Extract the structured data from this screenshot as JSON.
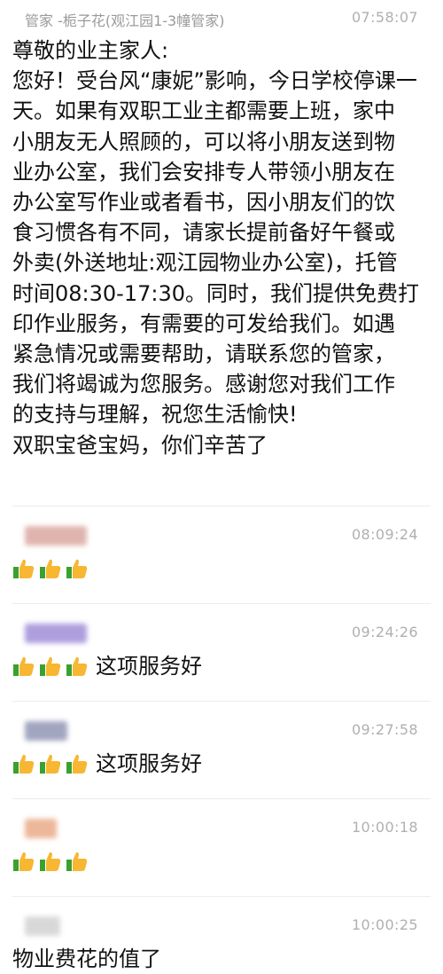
{
  "first_message": {
    "sender": "管家 -栀子花(观江园1-3幢管家)",
    "time": "07:58:07",
    "body": "尊敬的业主家人:\n您好！受台风“康妮”影响，今日学校停课一\n天。如果有双职工业主都需要上班，家中\n小朋友无人照顾的，可以将小朋友送到物\n业办公室，我们会安排专人带领小朋友在\n办公室写作业或者看书，因小朋友们的饮\n食习惯各有不同，请家长提前备好午餐或\n外卖(外送地址:观江园物业办公室)，托管\n时间08:30-17:30。同时，我们提供免费打\n印作业服务，有需要的可发给我们。如遇\n紧急情况或需要帮助，请联系您的管家，\n我们将竭诚为您服务。感谢您对我们工作\n的支持与理解，祝您生活愉快!\n双职宝爸宝妈，你们辛苦了"
  },
  "replies": [
    {
      "time": "08:09:24",
      "text": "",
      "thumbs": 3,
      "blur_color": "#d9a29a"
    },
    {
      "time": "09:24:26",
      "text": "这项服务好",
      "thumbs": 3,
      "blur_color": "#9a86d6"
    },
    {
      "time": "09:27:58",
      "text": "这项服务好",
      "thumbs": 3,
      "blur_color": "#8a8fb0"
    },
    {
      "time": "10:00:18",
      "text": "",
      "thumbs": 3,
      "blur_color": "#e8a580"
    },
    {
      "time": "10:00:25",
      "text": "物业费花的值了",
      "thumbs": 0,
      "blur_color": "#cfcfcf"
    }
  ],
  "icons": {
    "thumb": "thumbs-up-icon"
  },
  "colors": {
    "thumb_skin": "#f7b733",
    "thumb_cuff": "#3aa12f",
    "meta_text": "#9a9a9a",
    "divider": "#ececec"
  }
}
